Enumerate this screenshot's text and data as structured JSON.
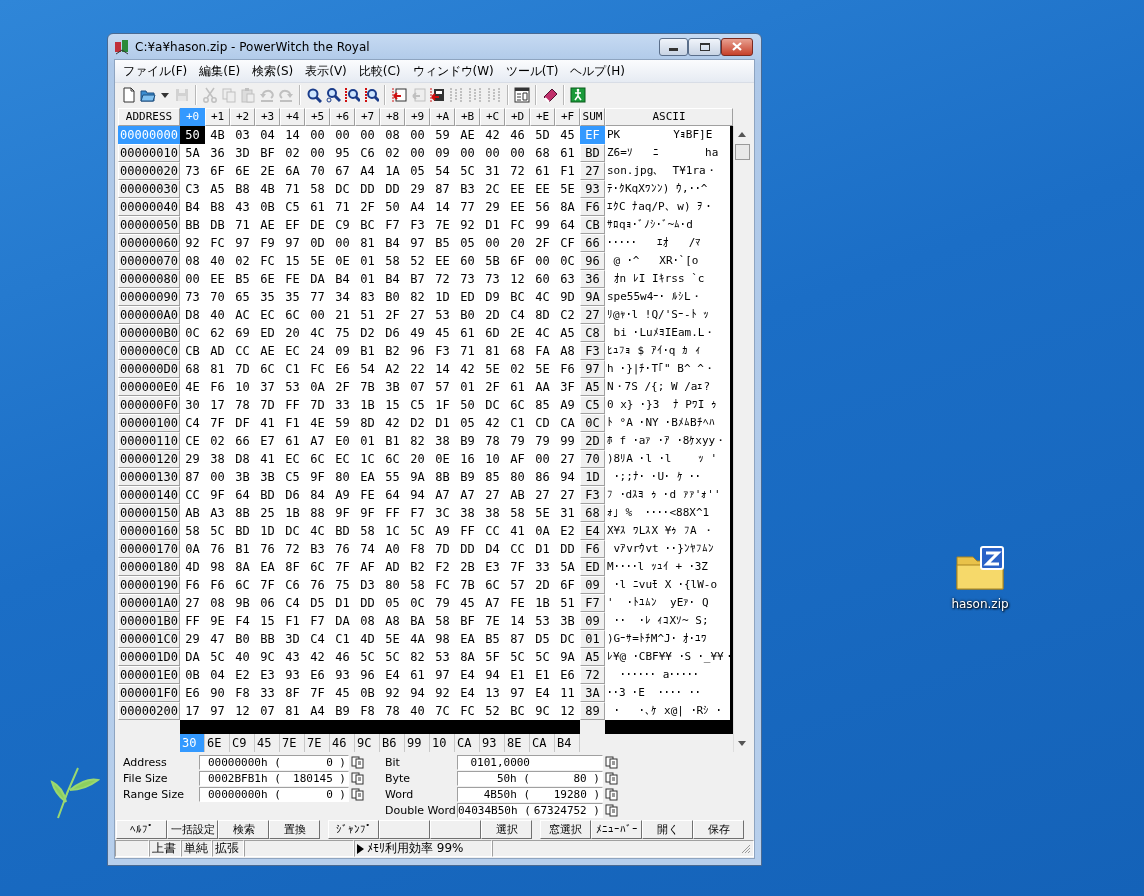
{
  "window": {
    "title": "C:¥a¥hason.zip - PowerWitch the Royal"
  },
  "menu": [
    "ファイル(F)",
    "編集(E)",
    "検索(S)",
    "表示(V)",
    "比較(C)",
    "ウィンドウ(W)",
    "ツール(T)",
    "ヘルプ(H)"
  ],
  "toolbar": [
    {
      "kind": "new",
      "disabled": false
    },
    {
      "kind": "open",
      "disabled": false
    },
    {
      "kind": "dropdown",
      "disabled": false
    },
    {
      "kind": "save",
      "disabled": true
    },
    {
      "kind": "sep"
    },
    {
      "kind": "cut",
      "disabled": true
    },
    {
      "kind": "copy",
      "disabled": true
    },
    {
      "kind": "paste",
      "disabled": true
    },
    {
      "kind": "undo",
      "disabled": true
    },
    {
      "kind": "redo",
      "disabled": true
    },
    {
      "kind": "sep"
    },
    {
      "kind": "search",
      "disabled": false
    },
    {
      "kind": "search-binary",
      "disabled": false
    },
    {
      "kind": "search-prev",
      "disabled": false
    },
    {
      "kind": "search-next",
      "disabled": false
    },
    {
      "kind": "sep"
    },
    {
      "kind": "compare-left",
      "disabled": false
    },
    {
      "kind": "compare-mid",
      "disabled": true
    },
    {
      "kind": "compare-right",
      "disabled": false
    },
    {
      "kind": "merge",
      "disabled": true
    },
    {
      "kind": "merge",
      "disabled": true
    },
    {
      "kind": "merge",
      "disabled": true
    },
    {
      "kind": "sep"
    },
    {
      "kind": "properties",
      "disabled": false
    },
    {
      "kind": "sep"
    },
    {
      "kind": "book",
      "disabled": false
    },
    {
      "kind": "sep"
    },
    {
      "kind": "exit",
      "disabled": false
    }
  ],
  "columns": [
    {
      "kind": "address",
      "label": "ADDRESS",
      "selected": false
    },
    {
      "kind": "byte",
      "label": "+0",
      "selected": true
    },
    {
      "kind": "byte",
      "label": "+1",
      "selected": false
    },
    {
      "kind": "byte",
      "label": "+2",
      "selected": false
    },
    {
      "kind": "byte",
      "label": "+3",
      "selected": false
    },
    {
      "kind": "byte",
      "label": "+4",
      "selected": false
    },
    {
      "kind": "byte",
      "label": "+5",
      "selected": false
    },
    {
      "kind": "byte",
      "label": "+6",
      "selected": false
    },
    {
      "kind": "byte",
      "label": "+7",
      "selected": false
    },
    {
      "kind": "byte",
      "label": "+8",
      "selected": false
    },
    {
      "kind": "byte",
      "label": "+9",
      "selected": false
    },
    {
      "kind": "byte",
      "label": "+A",
      "selected": false
    },
    {
      "kind": "byte",
      "label": "+B",
      "selected": false
    },
    {
      "kind": "byte",
      "label": "+C",
      "selected": false
    },
    {
      "kind": "byte",
      "label": "+D",
      "selected": false
    },
    {
      "kind": "byte",
      "label": "+E",
      "selected": false
    },
    {
      "kind": "byte",
      "label": "+F",
      "selected": false
    },
    {
      "kind": "sum",
      "label": "SUM",
      "selected": false
    },
    {
      "kind": "ascii",
      "label": "ASCII",
      "selected": false
    }
  ],
  "rows": [
    {
      "address": "00000000",
      "selected": true,
      "bytes": [
        "50",
        "4B",
        "03",
        "04",
        "14",
        "00",
        "00",
        "00",
        "08",
        "00",
        "59",
        "AE",
        "42",
        "46",
        "5D",
        "45"
      ],
      "sum": "EF",
      "ascii": "PK        YｮBF]E"
    },
    {
      "address": "00000010",
      "selected": false,
      "bytes": [
        "5A",
        "36",
        "3D",
        "BF",
        "02",
        "00",
        "95",
        "C6",
        "02",
        "00",
        "09",
        "00",
        "00",
        "00",
        "68",
        "61"
      ],
      "sum": "BD",
      "ascii": "Z6=ｿ   ﾆ       ha"
    },
    {
      "address": "00000020",
      "selected": false,
      "bytes": [
        "73",
        "6F",
        "6E",
        "2E",
        "6A",
        "70",
        "67",
        "A4",
        "1A",
        "05",
        "54",
        "5C",
        "31",
        "72",
        "61",
        "F1"
      ],
      "sum": "27",
      "ascii": "son.jpg､  T¥1ra・"
    },
    {
      "address": "00000030",
      "selected": false,
      "bytes": [
        "C3",
        "A5",
        "B8",
        "4B",
        "71",
        "58",
        "DC",
        "DD",
        "DD",
        "29",
        "87",
        "B3",
        "2C",
        "EE",
        "EE",
        "5E"
      ],
      "sum": "93",
      "ascii": "ﾃ･ｸKqXﾜﾝﾝ) ｳ,･･^"
    },
    {
      "address": "00000040",
      "selected": false,
      "bytes": [
        "B4",
        "B8",
        "43",
        "0B",
        "C5",
        "61",
        "71",
        "2F",
        "50",
        "A4",
        "14",
        "77",
        "29",
        "EE",
        "56",
        "8A"
      ],
      "sum": "F6",
      "ascii": "ｴｸC ﾅaq/P､ w) ｦ・"
    },
    {
      "address": "00000050",
      "selected": false,
      "bytes": [
        "BB",
        "DB",
        "71",
        "AE",
        "EF",
        "DE",
        "C9",
        "BC",
        "F7",
        "F3",
        "7E",
        "92",
        "D1",
        "FC",
        "99",
        "64"
      ],
      "sum": "CB",
      "ascii": "ｻﾛqｮ･ﾞﾉｼ･ﾞ~ﾑ･d"
    },
    {
      "address": "00000060",
      "selected": false,
      "bytes": [
        "92",
        "FC",
        "97",
        "F9",
        "97",
        "0D",
        "00",
        "81",
        "B4",
        "97",
        "B5",
        "05",
        "00",
        "20",
        "2F",
        "CF"
      ],
      "sum": "66",
      "ascii": "･････   ｴｵ   /ﾏ"
    },
    {
      "address": "00000070",
      "selected": false,
      "bytes": [
        "08",
        "40",
        "02",
        "FC",
        "15",
        "5E",
        "0E",
        "01",
        "58",
        "52",
        "EE",
        "60",
        "5B",
        "6F",
        "00",
        "0C"
      ],
      "sum": "96",
      "ascii": " @ ･^   XR･`[o"
    },
    {
      "address": "00000080",
      "selected": false,
      "bytes": [
        "00",
        "EE",
        "B5",
        "6E",
        "FE",
        "DA",
        "B4",
        "01",
        "B4",
        "B7",
        "72",
        "73",
        "73",
        "12",
        "60",
        "63"
      ],
      "sum": "36",
      "ascii": " ｵn ﾚI Iｷrss `c"
    },
    {
      "address": "00000090",
      "selected": false,
      "bytes": [
        "73",
        "70",
        "65",
        "35",
        "35",
        "77",
        "34",
        "83",
        "B0",
        "82",
        "1D",
        "ED",
        "D9",
        "BC",
        "4C",
        "9D"
      ],
      "sum": "9A",
      "ascii": "spe55w4ｰ･ ﾙｼL・"
    },
    {
      "address": "000000A0",
      "selected": false,
      "bytes": [
        "D8",
        "40",
        "AC",
        "EC",
        "6C",
        "00",
        "21",
        "51",
        "2F",
        "27",
        "53",
        "B0",
        "2D",
        "C4",
        "8D",
        "C2"
      ],
      "sum": "27",
      "ascii": "ﾘ@ｬ･l !Q/'Sｰ-ﾄ ｯ"
    },
    {
      "address": "000000B0",
      "selected": false,
      "bytes": [
        "0C",
        "62",
        "69",
        "ED",
        "20",
        "4C",
        "75",
        "D2",
        "D6",
        "49",
        "45",
        "61",
        "6D",
        "2E",
        "4C",
        "A5"
      ],
      "sum": "C8",
      "ascii": " bi ･LuﾒﾖIEam.L・"
    },
    {
      "address": "000000C0",
      "selected": false,
      "bytes": [
        "CB",
        "AD",
        "CC",
        "AE",
        "EC",
        "24",
        "09",
        "B1",
        "B2",
        "96",
        "F3",
        "71",
        "81",
        "68",
        "FA",
        "A8"
      ],
      "sum": "F3",
      "ascii": "ﾋｭﾌｮ $ ｱｲ･q ｶ ｨ"
    },
    {
      "address": "000000D0",
      "selected": false,
      "bytes": [
        "68",
        "81",
        "7D",
        "6C",
        "C1",
        "FC",
        "E6",
        "54",
        "A2",
        "22",
        "14",
        "42",
        "5E",
        "02",
        "5E",
        "F6"
      ],
      "sum": "97",
      "ascii": "h ･}|ﾁ･T｢\" B^ ^・"
    },
    {
      "address": "000000E0",
      "selected": false,
      "bytes": [
        "4E",
        "F6",
        "10",
        "37",
        "53",
        "0A",
        "2F",
        "7B",
        "3B",
        "07",
        "57",
        "01",
        "2F",
        "61",
        "AA",
        "3F"
      ],
      "sum": "A5",
      "ascii": "N・7S /{; W /aｪ?"
    },
    {
      "address": "000000F0",
      "selected": false,
      "bytes": [
        "30",
        "17",
        "78",
        "7D",
        "FF",
        "7D",
        "33",
        "1B",
        "15",
        "C5",
        "1F",
        "50",
        "DC",
        "6C",
        "85",
        "A9"
      ],
      "sum": "C5",
      "ascii": "0 x} ･}3  ﾅ PﾜI ｩ"
    },
    {
      "address": "00000100",
      "selected": false,
      "bytes": [
        "C4",
        "7F",
        "DF",
        "41",
        "F1",
        "4E",
        "59",
        "8D",
        "42",
        "D2",
        "D1",
        "05",
        "42",
        "C1",
        "CD",
        "CA"
      ],
      "sum": "0C",
      "ascii": "ﾄ °A ･NY ･BﾒﾑBﾁﾍﾊ"
    },
    {
      "address": "00000110",
      "selected": false,
      "bytes": [
        "CE",
        "02",
        "66",
        "E7",
        "61",
        "A7",
        "E0",
        "01",
        "B1",
        "82",
        "38",
        "B9",
        "78",
        "79",
        "79",
        "99"
      ],
      "sum": "2D",
      "ascii": "ﾎ f ･aｧ ･ｱ ･8ｹxyy・"
    },
    {
      "address": "00000120",
      "selected": false,
      "bytes": [
        "29",
        "38",
        "D8",
        "41",
        "EC",
        "6C",
        "EC",
        "1C",
        "6C",
        "20",
        "0E",
        "16",
        "10",
        "AF",
        "00",
        "27"
      ],
      "sum": "70",
      "ascii": ")8ﾘA ･l ･l    ｯ '"
    },
    {
      "address": "00000130",
      "selected": false,
      "bytes": [
        "87",
        "00",
        "3B",
        "3B",
        "C5",
        "9F",
        "80",
        "EA",
        "55",
        "9A",
        "8B",
        "B9",
        "85",
        "80",
        "86",
        "94"
      ],
      "sum": "1D",
      "ascii": " ･;;ﾅ･ ･U･ ｹ ･･"
    },
    {
      "address": "00000140",
      "selected": false,
      "bytes": [
        "CC",
        "9F",
        "64",
        "BD",
        "D6",
        "84",
        "A9",
        "FE",
        "64",
        "94",
        "A7",
        "A7",
        "27",
        "AB",
        "27",
        "27"
      ],
      "sum": "F3",
      "ascii": "ﾌ ･dｽﾖ ｩ ･d ｧｧ'ｫ''"
    },
    {
      "address": "00000150",
      "selected": false,
      "bytes": [
        "AB",
        "A3",
        "8B",
        "25",
        "1B",
        "88",
        "9F",
        "9F",
        "FF",
        "F7",
        "3C",
        "38",
        "38",
        "58",
        "5E",
        "31"
      ],
      "sum": "68",
      "ascii": "ｫ｣ %  ････<88X^1"
    },
    {
      "address": "00000160",
      "selected": false,
      "bytes": [
        "58",
        "5C",
        "BD",
        "1D",
        "DC",
        "4C",
        "BD",
        "58",
        "1C",
        "5C",
        "A9",
        "FF",
        "CC",
        "41",
        "0A",
        "E2"
      ],
      "sum": "E4",
      "ascii": "X¥ｽ ﾜLｽX ¥ｩ ﾌA ・"
    },
    {
      "address": "00000170",
      "selected": false,
      "bytes": [
        "0A",
        "76",
        "B1",
        "76",
        "72",
        "B3",
        "76",
        "74",
        "A0",
        "F8",
        "7D",
        "DD",
        "D4",
        "CC",
        "D1",
        "DD"
      ],
      "sum": "F6",
      "ascii": " vｱvrｳvt ･･}ﾝﾔﾌﾑﾝ"
    },
    {
      "address": "00000180",
      "selected": false,
      "bytes": [
        "4D",
        "98",
        "8A",
        "EA",
        "8F",
        "6C",
        "7F",
        "AF",
        "AD",
        "B2",
        "F2",
        "2B",
        "E3",
        "7F",
        "33",
        "5A"
      ],
      "sum": "ED",
      "ascii": "M････l ｯｭｲ + ･3Z"
    },
    {
      "address": "00000190",
      "selected": false,
      "bytes": [
        "F6",
        "F6",
        "6C",
        "7F",
        "C6",
        "76",
        "75",
        "D3",
        "80",
        "58",
        "FC",
        "7B",
        "6C",
        "57",
        "2D",
        "6F"
      ],
      "sum": "09",
      "ascii": " ･l ﾆvuﾓ X ･{lW-o"
    },
    {
      "address": "000001A0",
      "selected": false,
      "bytes": [
        "27",
        "08",
        "9B",
        "06",
        "C4",
        "D5",
        "D1",
        "DD",
        "05",
        "0C",
        "79",
        "45",
        "A7",
        "FE",
        "1B",
        "51"
      ],
      "sum": "F7",
      "ascii": "'  ･ﾄﾕﾑﾝ  yEｧ･ Q"
    },
    {
      "address": "000001B0",
      "selected": false,
      "bytes": [
        "FF",
        "9E",
        "F4",
        "15",
        "F1",
        "F7",
        "DA",
        "08",
        "A8",
        "BA",
        "58",
        "BF",
        "7E",
        "14",
        "53",
        "3B"
      ],
      "sum": "09",
      "ascii": " ･･  ･ﾚ ｨｺXｿ~ S;"
    },
    {
      "address": "000001C0",
      "selected": false,
      "bytes": [
        "29",
        "47",
        "B0",
        "BB",
        "3D",
        "C4",
        "C1",
        "4D",
        "5E",
        "4A",
        "98",
        "EA",
        "B5",
        "87",
        "D5",
        "DC"
      ],
      "sum": "01",
      "ascii": ")Gｰｻ=ﾄﾁM^J･ ｵ･ﾕﾜ"
    },
    {
      "address": "000001D0",
      "selected": false,
      "bytes": [
        "DA",
        "5C",
        "40",
        "9C",
        "43",
        "42",
        "46",
        "5C",
        "5C",
        "82",
        "53",
        "8A",
        "5F",
        "5C",
        "5C",
        "9A"
      ],
      "sum": "A5",
      "ascii": "ﾚ¥@ ･CBF¥¥ ･S ･_¥¥・"
    },
    {
      "address": "000001E0",
      "selected": false,
      "bytes": [
        "0B",
        "04",
        "E2",
        "E3",
        "93",
        "E6",
        "93",
        "96",
        "E4",
        "61",
        "97",
        "E4",
        "94",
        "E1",
        "E1",
        "E6"
      ],
      "sum": "72",
      "ascii": "  ･･････ a･････"
    },
    {
      "address": "000001F0",
      "selected": false,
      "bytes": [
        "E6",
        "90",
        "F8",
        "33",
        "8F",
        "7F",
        "45",
        "0B",
        "92",
        "94",
        "92",
        "E4",
        "13",
        "97",
        "E4",
        "11"
      ],
      "sum": "3A",
      "ascii": "･･3 ･E  ････ ･･"
    },
    {
      "address": "00000200",
      "selected": false,
      "bytes": [
        "17",
        "97",
        "12",
        "07",
        "81",
        "A4",
        "B9",
        "F8",
        "78",
        "40",
        "7C",
        "FC",
        "52",
        "BC",
        "9C",
        "12"
      ],
      "sum": "89",
      "ascii": " ･   ･､ｹ x@| ･Rｼ ･"
    }
  ],
  "edit_row": [
    "30",
    "6E",
    "C9",
    "45",
    "7E",
    "7E",
    "46",
    "9C",
    "B6",
    "99",
    "10",
    "CA",
    "93",
    "8E",
    "CA",
    "B4"
  ],
  "info_left": [
    {
      "label": "Address",
      "hex": "00000000h (",
      "dec": "0 )"
    },
    {
      "label": "File Size",
      "hex": "0002BFB1h (",
      "dec": "180145 )"
    },
    {
      "label": "Range Size",
      "hex": "00000000h (",
      "dec": "0 )"
    }
  ],
  "info_right": [
    {
      "label": "Bit",
      "hex": "0101,0000"
    },
    {
      "label": "Byte",
      "hex": "50h (",
      "dec": "80 )"
    },
    {
      "label": "Word",
      "hex": "4B50h (",
      "dec": "19280 )"
    },
    {
      "label": "Double Word",
      "hex": "04034B50h (",
      "dec": "67324752 )"
    }
  ],
  "function_keys": [
    {
      "kind": "label",
      "label": "ﾍﾙﾌﾟ"
    },
    {
      "kind": "label",
      "label": "一括設定"
    },
    {
      "kind": "label",
      "label": "検索"
    },
    {
      "kind": "label",
      "label": "置換"
    },
    {
      "kind": "label",
      "label": "ｼﾞｬﾝﾌﾟ"
    },
    {
      "kind": "blank"
    },
    {
      "kind": "blank"
    },
    {
      "kind": "label",
      "label": "選択"
    },
    {
      "kind": "label",
      "label": "窓選択"
    },
    {
      "kind": "label",
      "label": "ﾒﾆｭｰﾊﾞｰ"
    },
    {
      "kind": "label",
      "label": "開く"
    },
    {
      "kind": "label",
      "label": "保存"
    }
  ],
  "status_bar": [
    {
      "kind": "blank"
    },
    {
      "kind": "text",
      "text": "上書"
    },
    {
      "kind": "text",
      "text": "単純"
    },
    {
      "kind": "text",
      "text": "拡張"
    },
    {
      "kind": "blank"
    },
    {
      "kind": "indicator",
      "text": "ﾒﾓﾘ利用効率 99%"
    },
    {
      "kind": "grip"
    }
  ],
  "desktop_icons": [
    {
      "label": "hason.zip"
    }
  ]
}
